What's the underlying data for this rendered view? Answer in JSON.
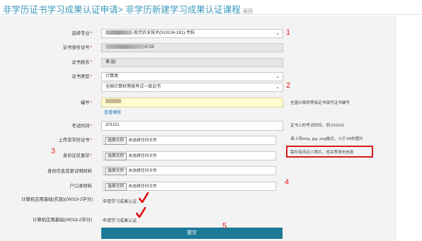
{
  "page": {
    "title": "非学历证书学习成果认证申请> 非学历新建学习成果认证课程",
    "back_link": "返回"
  },
  "form": {
    "major": {
      "label": "选择专业",
      "value_suffix": "-现代农业技术(510104-181)-专科"
    },
    "cert_id": {
      "label": "证书身份证号",
      "value_suffix": "4728"
    },
    "cert_name": {
      "label": "证书姓名",
      "value_suffix": "黄"
    },
    "cert_type": {
      "label": "证书类型",
      "value_1": "计算类",
      "value_2": "全国计算机等级考试一级证书",
      "hint": "全国计算机等级证书填写证书编号"
    },
    "serial": {
      "label": "编号",
      "sample_link": "查看模版"
    },
    "exam_date": {
      "label": "考试时间",
      "value": "201101",
      "hint": "证书上的考试时间，例:201103"
    },
    "upload_cert": {
      "label": "上传非学历证书",
      "hint": "请上传bmp, jpg, png格式，小于1M的图片"
    },
    "id_copy": {
      "label": "身份证反复印",
      "hint": "需印有持证人照片，姓名等身份信息"
    },
    "id_change": {
      "label": "身份信息变更证明材料"
    },
    "hukou": {
      "label": "户口本材料"
    },
    "file_button": "选择文件",
    "file_none": "未选择任何文件",
    "course_1": {
      "label": "计算机应用基础(实践)(00019-2学分)",
      "apply": "申请学习成果认证:"
    },
    "course_2": {
      "label": "计算机应用基础(00018-2学分)",
      "apply": "申请学习成果认证:"
    },
    "submit": "提交"
  },
  "annotations": {
    "n1": "1",
    "n2": "2",
    "n3": "3",
    "n4": "4",
    "n5": "5"
  },
  "colors": {
    "accent": "#3a98b8",
    "annotation": "#e02020",
    "submit_bg": "#1d7a96"
  }
}
